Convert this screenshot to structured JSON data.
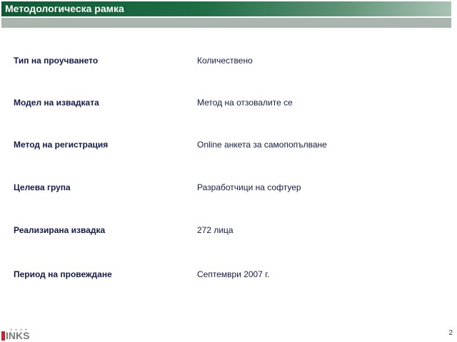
{
  "header": {
    "title": "Методологическа рамка"
  },
  "rows": [
    {
      "label": "Тип на проучването",
      "value": "Количествено"
    },
    {
      "label": "Модел на извадката",
      "value": "Метод на отзовалите се"
    },
    {
      "label": "Метод на регистрация",
      "value": "Online анкета за самопопълване"
    },
    {
      "label": "Целева група",
      "value": "Разработчици на софтуер"
    },
    {
      "label": "Реализирана извадка",
      "value": "272 лица"
    },
    {
      "label": "Период на провеждане",
      "value": "Септември 2007 г."
    }
  ],
  "footer": {
    "logo_text": "INKS",
    "page_number": "2"
  },
  "colors": {
    "title_bar": "#0e5a34",
    "sub_bar": "#a9b5ae",
    "text": "#141a4a",
    "logo_accent": "#c0272d"
  }
}
